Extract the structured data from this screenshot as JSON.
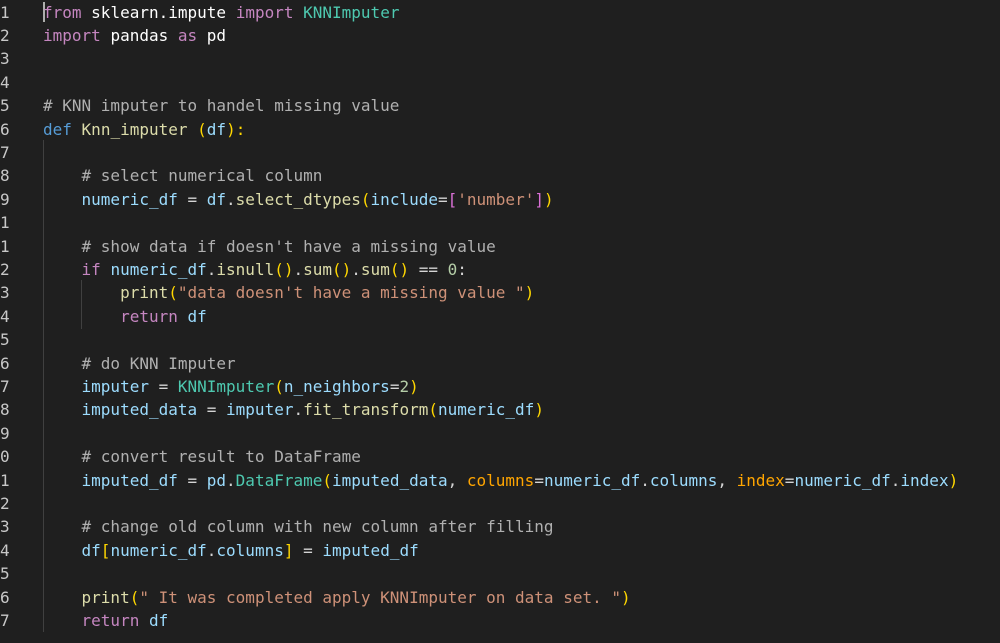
{
  "editor": {
    "line_numbers": [
      "1",
      "2",
      "3",
      "4",
      "5",
      "6",
      "7",
      "8",
      "9",
      "1",
      "1",
      "2",
      "3",
      "4",
      "5",
      "6",
      "7",
      "8",
      "9",
      "0",
      "1",
      "2",
      "3",
      "4",
      "5",
      "6",
      "7"
    ],
    "lines": [
      "from sklearn.impute import KNNImputer",
      "import pandas as pd",
      "",
      "",
      "# KNN imputer to handel missing value",
      "def Knn_imputer (df):",
      "",
      "    # select numerical column",
      "    numeric_df = df.select_dtypes(include=['number'])",
      "",
      "    # show data if doesn't have a missing value",
      "    if numeric_df.isnull().sum().sum() == 0:",
      "        print(\"data doesn't have a missing value \")",
      "        return df",
      "",
      "    # do KNN Imputer",
      "    imputer = KNNImputer(n_neighbors=2)",
      "    imputed_data = imputer.fit_transform(numeric_df)",
      "",
      "    # convert result to DataFrame",
      "    imputed_df = pd.DataFrame(imputed_data, columns=numeric_df.columns, index=numeric_df.index)",
      "",
      "    # change old column with new column after filling",
      "    df[numeric_df.columns] = imputed_df",
      "",
      "    print(\" It was completed apply KNNImputer on data set. \")",
      "    return df"
    ]
  },
  "tokens": {
    "l1": [
      "from",
      " ",
      "sklearn",
      ".",
      "impute",
      " ",
      "import",
      " ",
      "KNNImputer"
    ],
    "l2": [
      "import",
      " ",
      "pandas",
      " ",
      "as",
      " ",
      "pd"
    ],
    "l5": [
      "# KNN imputer to handel missing value"
    ],
    "l6": [
      "def",
      " ",
      "Knn_imputer",
      " ",
      "(",
      "df",
      "):"
    ],
    "l8": [
      "    ",
      "# select numerical column"
    ],
    "l9": [
      "    ",
      "numeric_df",
      " = ",
      "df",
      ".",
      "select_dtypes",
      "(",
      "include",
      "=",
      "[",
      "'number'",
      "]",
      ")"
    ],
    "l11": [
      "    ",
      "# show data if doesn't have a missing value"
    ],
    "l12": [
      "    ",
      "if",
      " ",
      "numeric_df",
      ".",
      "isnull",
      "()",
      ".",
      "sum",
      "()",
      ".",
      "sum",
      "()",
      " == ",
      "0",
      ":"
    ],
    "l13": [
      "        ",
      "print",
      "(",
      "\"data doesn't have a missing value \"",
      ")"
    ],
    "l14": [
      "        ",
      "return",
      " ",
      "df"
    ],
    "l16": [
      "    ",
      "# do KNN Imputer"
    ],
    "l17": [
      "    ",
      "imputer",
      " = ",
      "KNNImputer",
      "(",
      "n_neighbors",
      "=",
      "2",
      ")"
    ],
    "l18": [
      "    ",
      "imputed_data",
      " = ",
      "imputer",
      ".",
      "fit_transform",
      "(",
      "numeric_df",
      ")"
    ],
    "l20": [
      "    ",
      "# convert result to DataFrame"
    ],
    "l21": [
      "    ",
      "imputed_df",
      " = ",
      "pd",
      ".",
      "DataFrame",
      "(",
      "imputed_data",
      ", ",
      "columns",
      "=",
      "numeric_df",
      ".",
      "columns",
      ", ",
      "index",
      "=",
      "numeric_df",
      ".",
      "index",
      ")"
    ],
    "l23": [
      "    ",
      "# change old column with new column after filling"
    ],
    "l24": [
      "    ",
      "df",
      "[",
      "numeric_df",
      ".",
      "columns",
      "]",
      " = ",
      "imputed_df"
    ],
    "l26": [
      "    ",
      "print",
      "(",
      "\" It was completed apply KNNImputer on data set. \"",
      ")"
    ],
    "l27": [
      "    ",
      "return",
      " ",
      "df"
    ]
  },
  "colors": {
    "background": "#1f1f1f",
    "keyword": "#c586c0",
    "function": "#dcdcaa",
    "variable": "#9cdcfe",
    "class": "#4ec9b0",
    "string": "#ce9178",
    "number": "#b5cea8",
    "comment": "#b0b0b0",
    "bracket_level1": "#ffd700",
    "bracket_level2": "#da70d6",
    "bracket_level3": "#179fff",
    "kwarg": "#ffa500"
  }
}
